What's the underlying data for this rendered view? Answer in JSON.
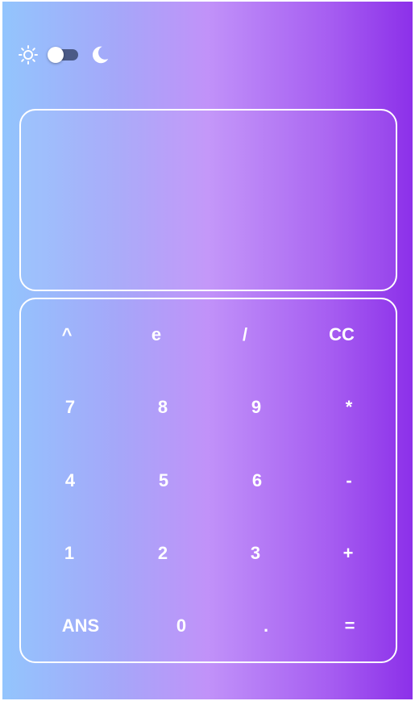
{
  "theme": {
    "light_icon": "sun-icon",
    "dark_icon": "moon-icon",
    "dark_mode": false,
    "track_color": "#4b5a86"
  },
  "display": {
    "value": ""
  },
  "keypad": {
    "rows": [
      [
        "^",
        "e",
        "/",
        "CC"
      ],
      [
        "7",
        "8",
        "9",
        "*"
      ],
      [
        "4",
        "5",
        "6",
        "-"
      ],
      [
        "1",
        "2",
        "3",
        "+"
      ],
      [
        "ANS",
        "0",
        ".",
        "="
      ]
    ]
  },
  "colors": {
    "gradient_start": "#93c5fd",
    "gradient_mid": "#c192f9",
    "gradient_end": "#8c30e9",
    "text": "#ffffff"
  }
}
